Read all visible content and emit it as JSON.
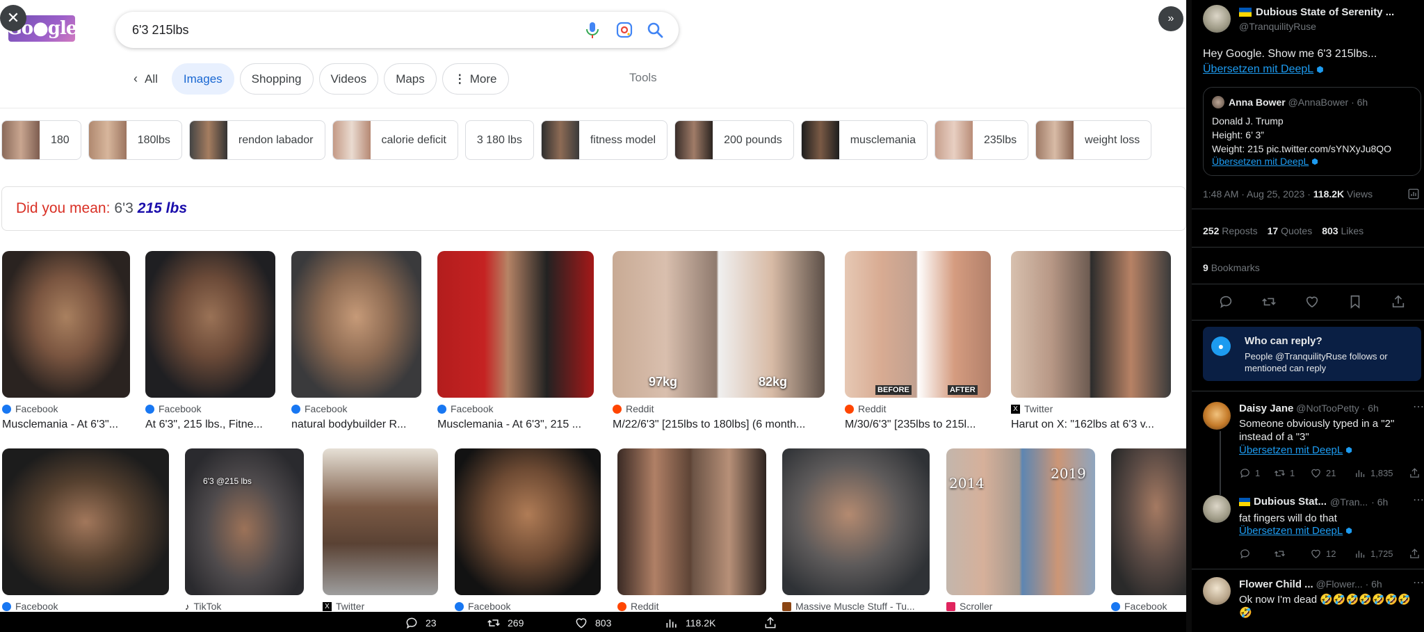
{
  "search": {
    "query": "6'3 215lbs",
    "mic_icon": "mic-icon",
    "lens_icon": "camera-lens-icon",
    "search_icon": "search-icon"
  },
  "tabs": {
    "back_label": "All",
    "items": [
      "Images",
      "Shopping",
      "Videos",
      "Maps",
      "More"
    ],
    "tools_label": "Tools"
  },
  "chips": [
    "180",
    "180lbs",
    "rendon labador",
    "calorie deficit",
    "3 180 lbs",
    "fitness model",
    "200 pounds",
    "musclemania",
    "235lbs",
    "weight loss"
  ],
  "did_you_mean": {
    "prefix": "Did you mean:",
    "original": "6'3",
    "suggestion": "215 lbs"
  },
  "results_row1": [
    {
      "source": "Facebook",
      "title": "Musclemania - At 6'3\"..."
    },
    {
      "source": "Facebook",
      "title": "At 6'3\", 215 lbs., Fitne..."
    },
    {
      "source": "Facebook",
      "title": "natural bodybuilder R..."
    },
    {
      "source": "Facebook",
      "title": "Musclemania - At 6'3\", 215 ..."
    },
    {
      "source": "Reddit",
      "title": "M/22/6'3\" [215lbs to 180lbs] (6 month...",
      "overlay_left": "97kg",
      "overlay_right": "82kg"
    },
    {
      "source": "Reddit",
      "title": "M/30/6'3\" [235lbs to 215l...",
      "overlay_left": "BEFORE",
      "overlay_right": "AFTER"
    },
    {
      "source": "Twitter",
      "title": "Harut on X: \"162lbs at 6'3 v..."
    }
  ],
  "results_row2": [
    {
      "source": "Facebook"
    },
    {
      "source": "TikTok",
      "overlay": "6'3 @215 lbs"
    },
    {
      "source": "Twitter"
    },
    {
      "source": "Facebook"
    },
    {
      "source": "Reddit"
    },
    {
      "source": "Massive Muscle Stuff - Tu..."
    },
    {
      "source": "Scroller",
      "overlay_left": "2014",
      "overlay_right": "2019"
    },
    {
      "source": "Facebook"
    }
  ],
  "bottom_bar": {
    "replies": "23",
    "reposts": "269",
    "likes": "803",
    "views": "118.2K"
  },
  "tweet": {
    "display_name": "Dubious State of Serenity ...",
    "handle": "@TranquilityRuse",
    "text": "Hey Google. Show me 6'3 215lbs...",
    "translate": "Übersetzen mit DeepL",
    "quote": {
      "name": "Anna Bower",
      "handle": "@AnnaBower",
      "time": "6h",
      "line1": "Donald J. Trump",
      "line2": "Height: 6’ 3”",
      "line3": "Weight: 215 pic.twitter.com/sYNXyJu8QO",
      "translate": "Übersetzen mit DeepL"
    },
    "timestamp": "1:48 AM · Aug 25, 2023 · ",
    "views_num": "118.2K",
    "views_label": "Views",
    "reposts_num": "252",
    "reposts_label": "Reposts",
    "quotes_num": "17",
    "quotes_label": "Quotes",
    "likes_num": "803",
    "likes_label": "Likes",
    "bookmarks_num": "9",
    "bookmarks_label": "Bookmarks"
  },
  "who_can_reply": {
    "title": "Who can reply?",
    "text": "People @TranquilityRuse follows or mentioned can reply"
  },
  "replies": [
    {
      "name": "Daisy Jane",
      "handle": "@NotTooPetty",
      "time": "· 6h",
      "text": "Someone obviously typed in a \"2\" instead of a \"3\"",
      "translate": "Übersetzen mit DeepL",
      "replies": "1",
      "reposts": "1",
      "likes": "21",
      "views": "1,835"
    },
    {
      "name": "Dubious Stat...",
      "handle": "@Tran...",
      "time": "· 6h",
      "text": "fat fingers will do that",
      "translate": "Übersetzen mit DeepL",
      "likes": "12",
      "views": "1,725"
    },
    {
      "name": "Flower Child ...",
      "handle": "@Flower...",
      "time": "· 6h",
      "text": "Ok now I'm dead 🤣🤣🤣🤣🤣🤣🤣🤣"
    }
  ],
  "colors": {
    "google_blue": "#1967d2",
    "link_blue": "#1d9bf0",
    "suggest_red": "#d93025",
    "facebook": "#1877f2",
    "reddit": "#ff4500",
    "twitter_bg": "#000000",
    "banner_bg": "#0a1f44"
  }
}
